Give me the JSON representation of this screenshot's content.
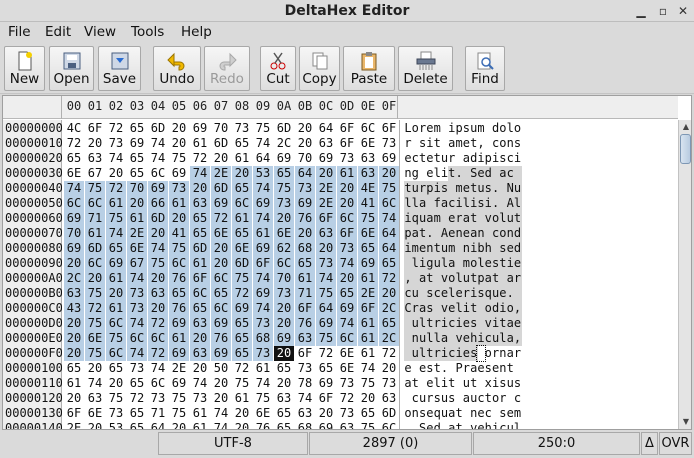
{
  "window": {
    "title": "DeltaHex Editor"
  },
  "menu": {
    "file": "File",
    "edit": "Edit",
    "view": "View",
    "tools": "Tools",
    "help": "Help"
  },
  "toolbar": {
    "new": "New",
    "open": "Open",
    "save": "Save",
    "undo": "Undo",
    "redo": "Redo",
    "cut": "Cut",
    "copy": "Copy",
    "paste": "Paste",
    "delete": "Delete",
    "find": "Find"
  },
  "columns": [
    "00",
    "01",
    "02",
    "03",
    "04",
    "05",
    "06",
    "07",
    "08",
    "09",
    "0A",
    "0B",
    "0C",
    "0D",
    "0E",
    "0F"
  ],
  "rows": [
    {
      "addr": "00000000",
      "hex": [
        "4C",
        "6F",
        "72",
        "65",
        "6D",
        "20",
        "69",
        "70",
        "73",
        "75",
        "6D",
        "20",
        "64",
        "6F",
        "6C",
        "6F"
      ],
      "text": "Lorem ipsum dolo"
    },
    {
      "addr": "00000010",
      "hex": [
        "72",
        "20",
        "73",
        "69",
        "74",
        "20",
        "61",
        "6D",
        "65",
        "74",
        "2C",
        "20",
        "63",
        "6F",
        "6E",
        "73"
      ],
      "text": "r sit amet, cons"
    },
    {
      "addr": "00000020",
      "hex": [
        "65",
        "63",
        "74",
        "65",
        "74",
        "75",
        "72",
        "20",
        "61",
        "64",
        "69",
        "70",
        "69",
        "73",
        "63",
        "69"
      ],
      "text": "ectetur adipisci"
    },
    {
      "addr": "00000030",
      "hex": [
        "6E",
        "67",
        "20",
        "65",
        "6C",
        "69",
        "74",
        "2E",
        "20",
        "53",
        "65",
        "64",
        "20",
        "61",
        "63",
        "20"
      ],
      "text": "ng elit. Sed ac "
    },
    {
      "addr": "00000040",
      "hex": [
        "74",
        "75",
        "72",
        "70",
        "69",
        "73",
        "20",
        "6D",
        "65",
        "74",
        "75",
        "73",
        "2E",
        "20",
        "4E",
        "75"
      ],
      "text": "turpis metus. Nu"
    },
    {
      "addr": "00000050",
      "hex": [
        "6C",
        "6C",
        "61",
        "20",
        "66",
        "61",
        "63",
        "69",
        "6C",
        "69",
        "73",
        "69",
        "2E",
        "20",
        "41",
        "6C"
      ],
      "text": "lla facilisi. Al"
    },
    {
      "addr": "00000060",
      "hex": [
        "69",
        "71",
        "75",
        "61",
        "6D",
        "20",
        "65",
        "72",
        "61",
        "74",
        "20",
        "76",
        "6F",
        "6C",
        "75",
        "74"
      ],
      "text": "iquam erat volut"
    },
    {
      "addr": "00000070",
      "hex": [
        "70",
        "61",
        "74",
        "2E",
        "20",
        "41",
        "65",
        "6E",
        "65",
        "61",
        "6E",
        "20",
        "63",
        "6F",
        "6E",
        "64"
      ],
      "text": "pat. Aenean cond"
    },
    {
      "addr": "00000080",
      "hex": [
        "69",
        "6D",
        "65",
        "6E",
        "74",
        "75",
        "6D",
        "20",
        "6E",
        "69",
        "62",
        "68",
        "20",
        "73",
        "65",
        "64"
      ],
      "text": "imentum nibh sed"
    },
    {
      "addr": "00000090",
      "hex": [
        "20",
        "6C",
        "69",
        "67",
        "75",
        "6C",
        "61",
        "20",
        "6D",
        "6F",
        "6C",
        "65",
        "73",
        "74",
        "69",
        "65"
      ],
      "text": " ligula molestie"
    },
    {
      "addr": "000000A0",
      "hex": [
        "2C",
        "20",
        "61",
        "74",
        "20",
        "76",
        "6F",
        "6C",
        "75",
        "74",
        "70",
        "61",
        "74",
        "20",
        "61",
        "72"
      ],
      "text": ", at volutpat ar"
    },
    {
      "addr": "000000B0",
      "hex": [
        "63",
        "75",
        "20",
        "73",
        "63",
        "65",
        "6C",
        "65",
        "72",
        "69",
        "73",
        "71",
        "75",
        "65",
        "2E",
        "20"
      ],
      "text": "cu scelerisque. "
    },
    {
      "addr": "000000C0",
      "hex": [
        "43",
        "72",
        "61",
        "73",
        "20",
        "76",
        "65",
        "6C",
        "69",
        "74",
        "20",
        "6F",
        "64",
        "69",
        "6F",
        "2C"
      ],
      "text": "Cras velit odio,"
    },
    {
      "addr": "000000D0",
      "hex": [
        "20",
        "75",
        "6C",
        "74",
        "72",
        "69",
        "63",
        "69",
        "65",
        "73",
        "20",
        "76",
        "69",
        "74",
        "61",
        "65"
      ],
      "text": " ultricies vitae"
    },
    {
      "addr": "000000E0",
      "hex": [
        "20",
        "6E",
        "75",
        "6C",
        "6C",
        "61",
        "20",
        "76",
        "65",
        "68",
        "69",
        "63",
        "75",
        "6C",
        "61",
        "2C"
      ],
      "text": " nulla vehicula,"
    },
    {
      "addr": "000000F0",
      "hex": [
        "20",
        "75",
        "6C",
        "74",
        "72",
        "69",
        "63",
        "69",
        "65",
        "73",
        "20",
        "6F",
        "72",
        "6E",
        "61",
        "72"
      ],
      "text": " ultricies ornar"
    },
    {
      "addr": "00000100",
      "hex": [
        "65",
        "20",
        "65",
        "73",
        "74",
        "2E",
        "20",
        "50",
        "72",
        "61",
        "65",
        "73",
        "65",
        "6E",
        "74",
        "20"
      ],
      "text": "e est. Praesent "
    },
    {
      "addr": "00000110",
      "hex": [
        "61",
        "74",
        "20",
        "65",
        "6C",
        "69",
        "74",
        "20",
        "75",
        "74",
        "20",
        "78",
        "69",
        "73",
        "75",
        "73"
      ],
      "text": "at elit ut xisus"
    },
    {
      "addr": "00000120",
      "hex": [
        "20",
        "63",
        "75",
        "72",
        "73",
        "75",
        "73",
        "20",
        "61",
        "75",
        "63",
        "74",
        "6F",
        "72",
        "20",
        "63"
      ],
      "text": " cursus auctor c"
    },
    {
      "addr": "00000130",
      "hex": [
        "6F",
        "6E",
        "73",
        "65",
        "71",
        "75",
        "61",
        "74",
        "20",
        "6E",
        "65",
        "63",
        "20",
        "73",
        "65",
        "6D"
      ],
      "text": "onsequat nec sem"
    },
    {
      "addr": "00000140",
      "hex": [
        "2E",
        "20",
        "53",
        "65",
        "64",
        "20",
        "61",
        "74",
        "20",
        "76",
        "65",
        "68",
        "69",
        "63",
        "75",
        "6C"
      ],
      "text": ". Sed at vehicul"
    }
  ],
  "selection": {
    "start": 54,
    "end": 249,
    "cursor": 250
  },
  "status": {
    "encoding": "UTF-8",
    "length": "2897 (0)",
    "position": "250:0",
    "delta": "Δ",
    "mode": "OVR"
  },
  "colors": {
    "hex_selection": "#b8cfe5",
    "text_selection": "#d6d6d6"
  }
}
